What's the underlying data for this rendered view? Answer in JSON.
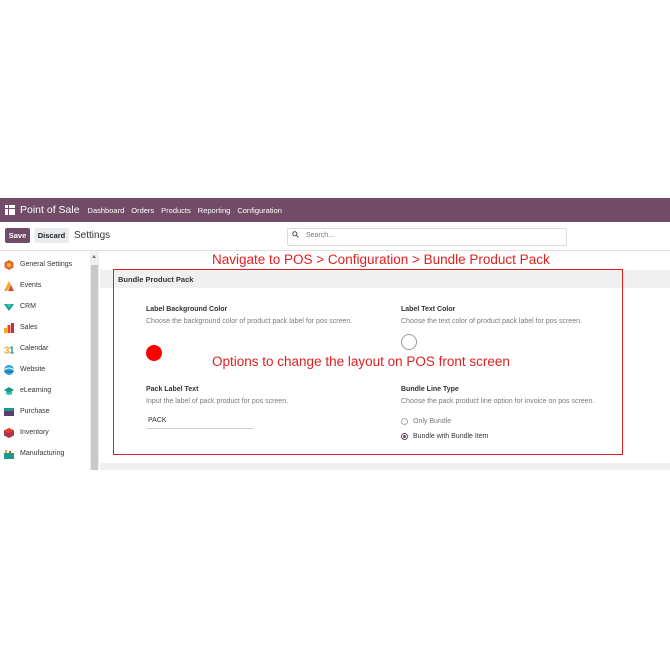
{
  "navbar": {
    "app_title": "Point of Sale",
    "menu": [
      "Dashboard",
      "Orders",
      "Products",
      "Reporting",
      "Configuration"
    ],
    "color": "#714b67"
  },
  "control_panel": {
    "save_label": "Save",
    "discard_label": "Discard",
    "breadcrumb": "Settings",
    "search_placeholder": "Search..."
  },
  "sidebar": {
    "items": [
      {
        "label": "General Settings",
        "icon": "general-settings-icon"
      },
      {
        "label": "Events",
        "icon": "events-icon"
      },
      {
        "label": "CRM",
        "icon": "crm-icon"
      },
      {
        "label": "Sales",
        "icon": "sales-icon"
      },
      {
        "label": "Calendar",
        "icon": "calendar-icon"
      },
      {
        "label": "Website",
        "icon": "website-icon"
      },
      {
        "label": "eLearning",
        "icon": "elearning-icon"
      },
      {
        "label": "Purchase",
        "icon": "purchase-icon"
      },
      {
        "label": "Inventory",
        "icon": "inventory-icon"
      },
      {
        "label": "Manufacturing",
        "icon": "manufacturing-icon"
      }
    ]
  },
  "annotations": {
    "navigate_note": "Navigate to POS > Configuration > Bundle Product Pack",
    "options_note": "Options to change the layout on POS front screen",
    "color": "#e0201f"
  },
  "section": {
    "title": "Bundle Product Pack"
  },
  "settings": {
    "label_bg": {
      "title": "Label Background Color",
      "desc": "Choose the background color of product pack label for pos screen.",
      "value_color": "#ff0000"
    },
    "label_text": {
      "title": "Label Text Color",
      "desc": "Choose the text color of product pack label for pos screen.",
      "value_color": "#ffffff"
    },
    "pack_label": {
      "title": "Pack Label Text",
      "desc": "Input the label of pack product for pos screen.",
      "value": "PACK"
    },
    "bundle_line": {
      "title": "Bundle Line Type",
      "desc": "Choose the pack product line option for invoice on pos screen.",
      "options": [
        "Only Bundle",
        "Bundle with Bundle Item"
      ],
      "selected": "Bundle with Bundle Item"
    }
  }
}
